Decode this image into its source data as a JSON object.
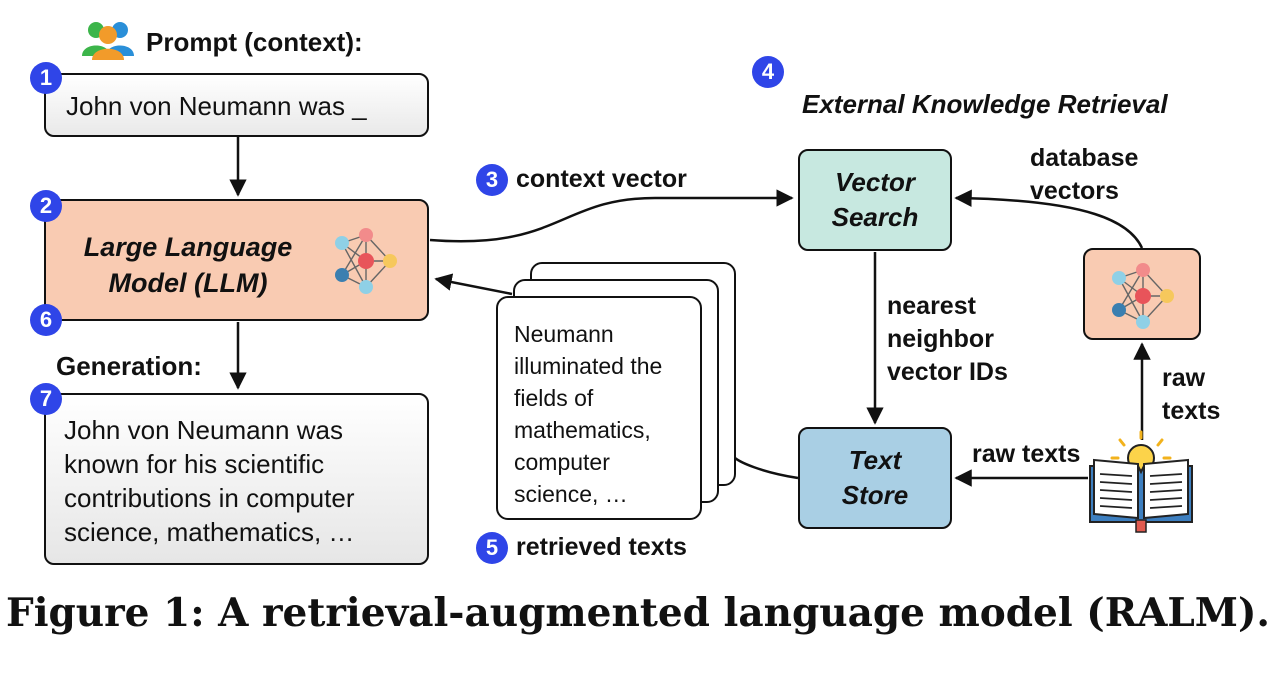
{
  "prompt_header": "Prompt (context):",
  "prompt_text": "John von Neumann was _",
  "llm_label": "Large Language Model (LLM)",
  "generation_header": "Generation:",
  "generation_text": "John von Neumann was known for his scientific contributions in computer science, mathematics, …",
  "context_vector_label": "context vector",
  "retrieved_texts_label": "retrieved texts",
  "retrieved_document_text": "Neumann illuminated the fields of mathematics, computer science, …",
  "ekr_title": "External Knowledge Retrieval",
  "vector_search_label": "Vector Search",
  "text_store_label": "Text Store",
  "nearest_neighbor_label": "nearest neighbor vector IDs",
  "database_vectors_label": "database vectors",
  "raw_texts_up_label": "raw texts",
  "raw_texts_left_label": "raw texts",
  "step_numbers": [
    "1",
    "2",
    "3",
    "4",
    "5",
    "6",
    "7"
  ],
  "caption": "Figure 1: A retrieval-augmented language model (RALM).",
  "colors": {
    "accent_blue": "#2f45e8",
    "llm_fill": "#f9cbb2",
    "vector_search_fill": "#c7e8e0",
    "text_store_fill": "#a9cfe4",
    "ekr_fill": "#fdf8f3"
  }
}
